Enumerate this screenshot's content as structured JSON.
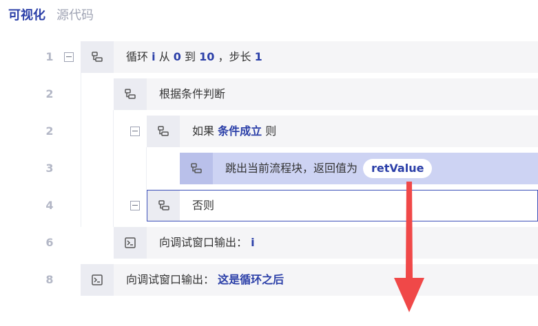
{
  "tabs": {
    "visual": "可视化",
    "source": "源代码"
  },
  "rows": [
    {
      "line": "1",
      "parts": [
        "循环",
        "i",
        "从",
        "0",
        "到",
        "10",
        "，步长",
        "1"
      ]
    },
    {
      "line": "2",
      "text": "根据条件判断"
    },
    {
      "line": "2",
      "prefix": "如果",
      "keyword": "条件成立",
      "suffix": "则"
    },
    {
      "line": "3",
      "text": "跳出当前流程块，返回值为",
      "pill": "retValue"
    },
    {
      "line": "4",
      "text": "否则"
    },
    {
      "line": "6",
      "text": "向调试窗口输出：",
      "keyword": "i"
    },
    {
      "line": "8",
      "text": "向调试窗口输出：",
      "keyword": "这是循环之后"
    }
  ],
  "colors": {
    "accent": "#2b3fa8",
    "selected_block": "#cdd3f3",
    "arrow": "#f04848"
  },
  "icons": {
    "block": "block-flow-icon",
    "terminal": "terminal-icon",
    "collapse": "collapse-minus-icon",
    "arrow": "down-arrow-icon"
  }
}
